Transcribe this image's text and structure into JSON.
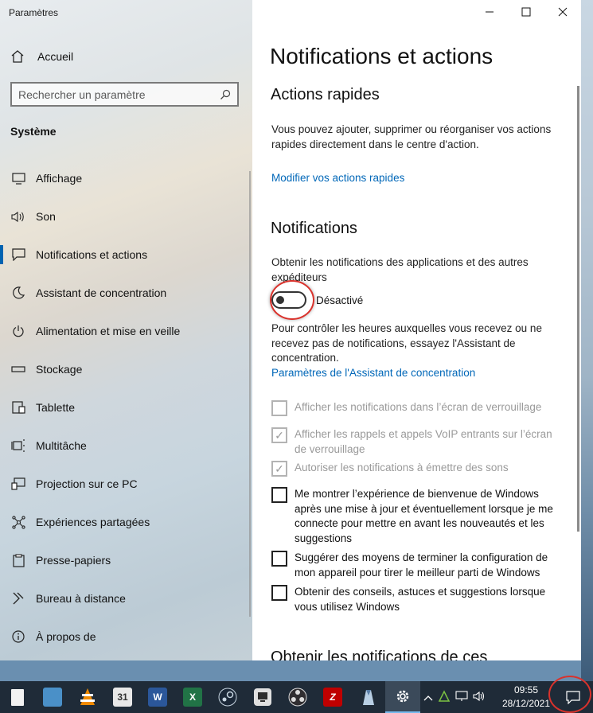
{
  "window": {
    "app_title": "Paramètres",
    "minimize_icon": "minimize-icon",
    "maximize_icon": "maximize-icon",
    "close_icon": "close-icon"
  },
  "sidebar": {
    "home_label": "Accueil",
    "search_placeholder": "Rechercher un paramètre",
    "section": "Système",
    "items": [
      {
        "label": "Affichage",
        "icon": "display-icon"
      },
      {
        "label": "Son",
        "icon": "speaker-icon"
      },
      {
        "label": "Notifications et actions",
        "icon": "notification-icon",
        "active": true
      },
      {
        "label": "Assistant de concentration",
        "icon": "moon-icon"
      },
      {
        "label": "Alimentation et mise en veille",
        "icon": "power-icon"
      },
      {
        "label": "Stockage",
        "icon": "storage-icon"
      },
      {
        "label": "Tablette",
        "icon": "tablet-icon"
      },
      {
        "label": "Multitâche",
        "icon": "multitask-icon"
      },
      {
        "label": "Projection sur ce PC",
        "icon": "projection-icon"
      },
      {
        "label": "Expériences partagées",
        "icon": "shared-icon"
      },
      {
        "label": "Presse-papiers",
        "icon": "clipboard-icon"
      },
      {
        "label": "Bureau à distance",
        "icon": "remote-desktop-icon"
      },
      {
        "label": "À propos de",
        "icon": "info-icon"
      }
    ]
  },
  "content": {
    "page_title": "Notifications et actions",
    "quick_actions": {
      "heading": "Actions rapides",
      "description": "Vous pouvez ajouter, supprimer ou réorganiser vos actions rapides directement dans le centre d'action.",
      "link": "Modifier vos actions rapides"
    },
    "notifications": {
      "heading": "Notifications",
      "toggle_label": "Obtenir les notifications des applications et des autres expéditeurs",
      "toggle_state": "Désactivé",
      "toggle_on": false,
      "assist_text": "Pour contrôler les heures auxquelles vous recevez ou ne recevez pas de notifications, essayez l'Assistant de concentration.",
      "assist_link": "Paramètres de l'Assistant de concentration",
      "checkboxes": [
        {
          "label": "Afficher les notifications dans l’écran de verrouillage",
          "checked": false,
          "disabled": true
        },
        {
          "label": "Afficher les rappels et appels VoIP entrants sur l’écran de verrouillage",
          "checked": true,
          "disabled": true
        },
        {
          "label": "Autoriser les notifications à émettre des sons",
          "checked": true,
          "disabled": true
        },
        {
          "label": "Me montrer l’expérience de bienvenue de Windows après une mise à jour et éventuellement lorsque je me connecte pour mettre en avant les nouveautés et les suggestions",
          "checked": false,
          "disabled": false
        },
        {
          "label": "Suggérer des moyens de terminer la configuration de mon appareil pour tirer le meilleur parti de Windows",
          "checked": false,
          "disabled": false
        },
        {
          "label": "Obtenir des conseils, astuces et suggestions lorsque vous utilisez Windows",
          "checked": false,
          "disabled": false
        }
      ]
    },
    "cut_heading": "Obtenir les notifications de ces"
  },
  "taskbar": {
    "apps": [
      {
        "name": "file-icon",
        "label": "",
        "color": "#f2f2f2"
      },
      {
        "name": "photo-app-icon",
        "label": "",
        "color": "#4a90c8"
      },
      {
        "name": "vlc-icon",
        "label": "",
        "color": "#f08a00"
      },
      {
        "name": "calendar-icon",
        "label": "31",
        "color": "#e8e8e8"
      },
      {
        "name": "word-icon",
        "label": "W",
        "color": "#2b579a"
      },
      {
        "name": "excel-icon",
        "label": "X",
        "color": "#217346"
      },
      {
        "name": "steam-icon",
        "label": "",
        "color": "#1b2838"
      },
      {
        "name": "remote-icon",
        "label": "",
        "color": "#2d2d2d"
      },
      {
        "name": "obs-icon",
        "label": "",
        "color": "#302e31"
      },
      {
        "name": "filezilla-icon",
        "label": "Z",
        "color": "#bf0000"
      },
      {
        "name": "cleaner-icon",
        "label": "",
        "color": "#5a7fa8"
      },
      {
        "name": "settings-icon",
        "label": "",
        "color": "#3b4a5a",
        "active": true
      }
    ],
    "time": "09:55",
    "date": "28/12/2021"
  }
}
